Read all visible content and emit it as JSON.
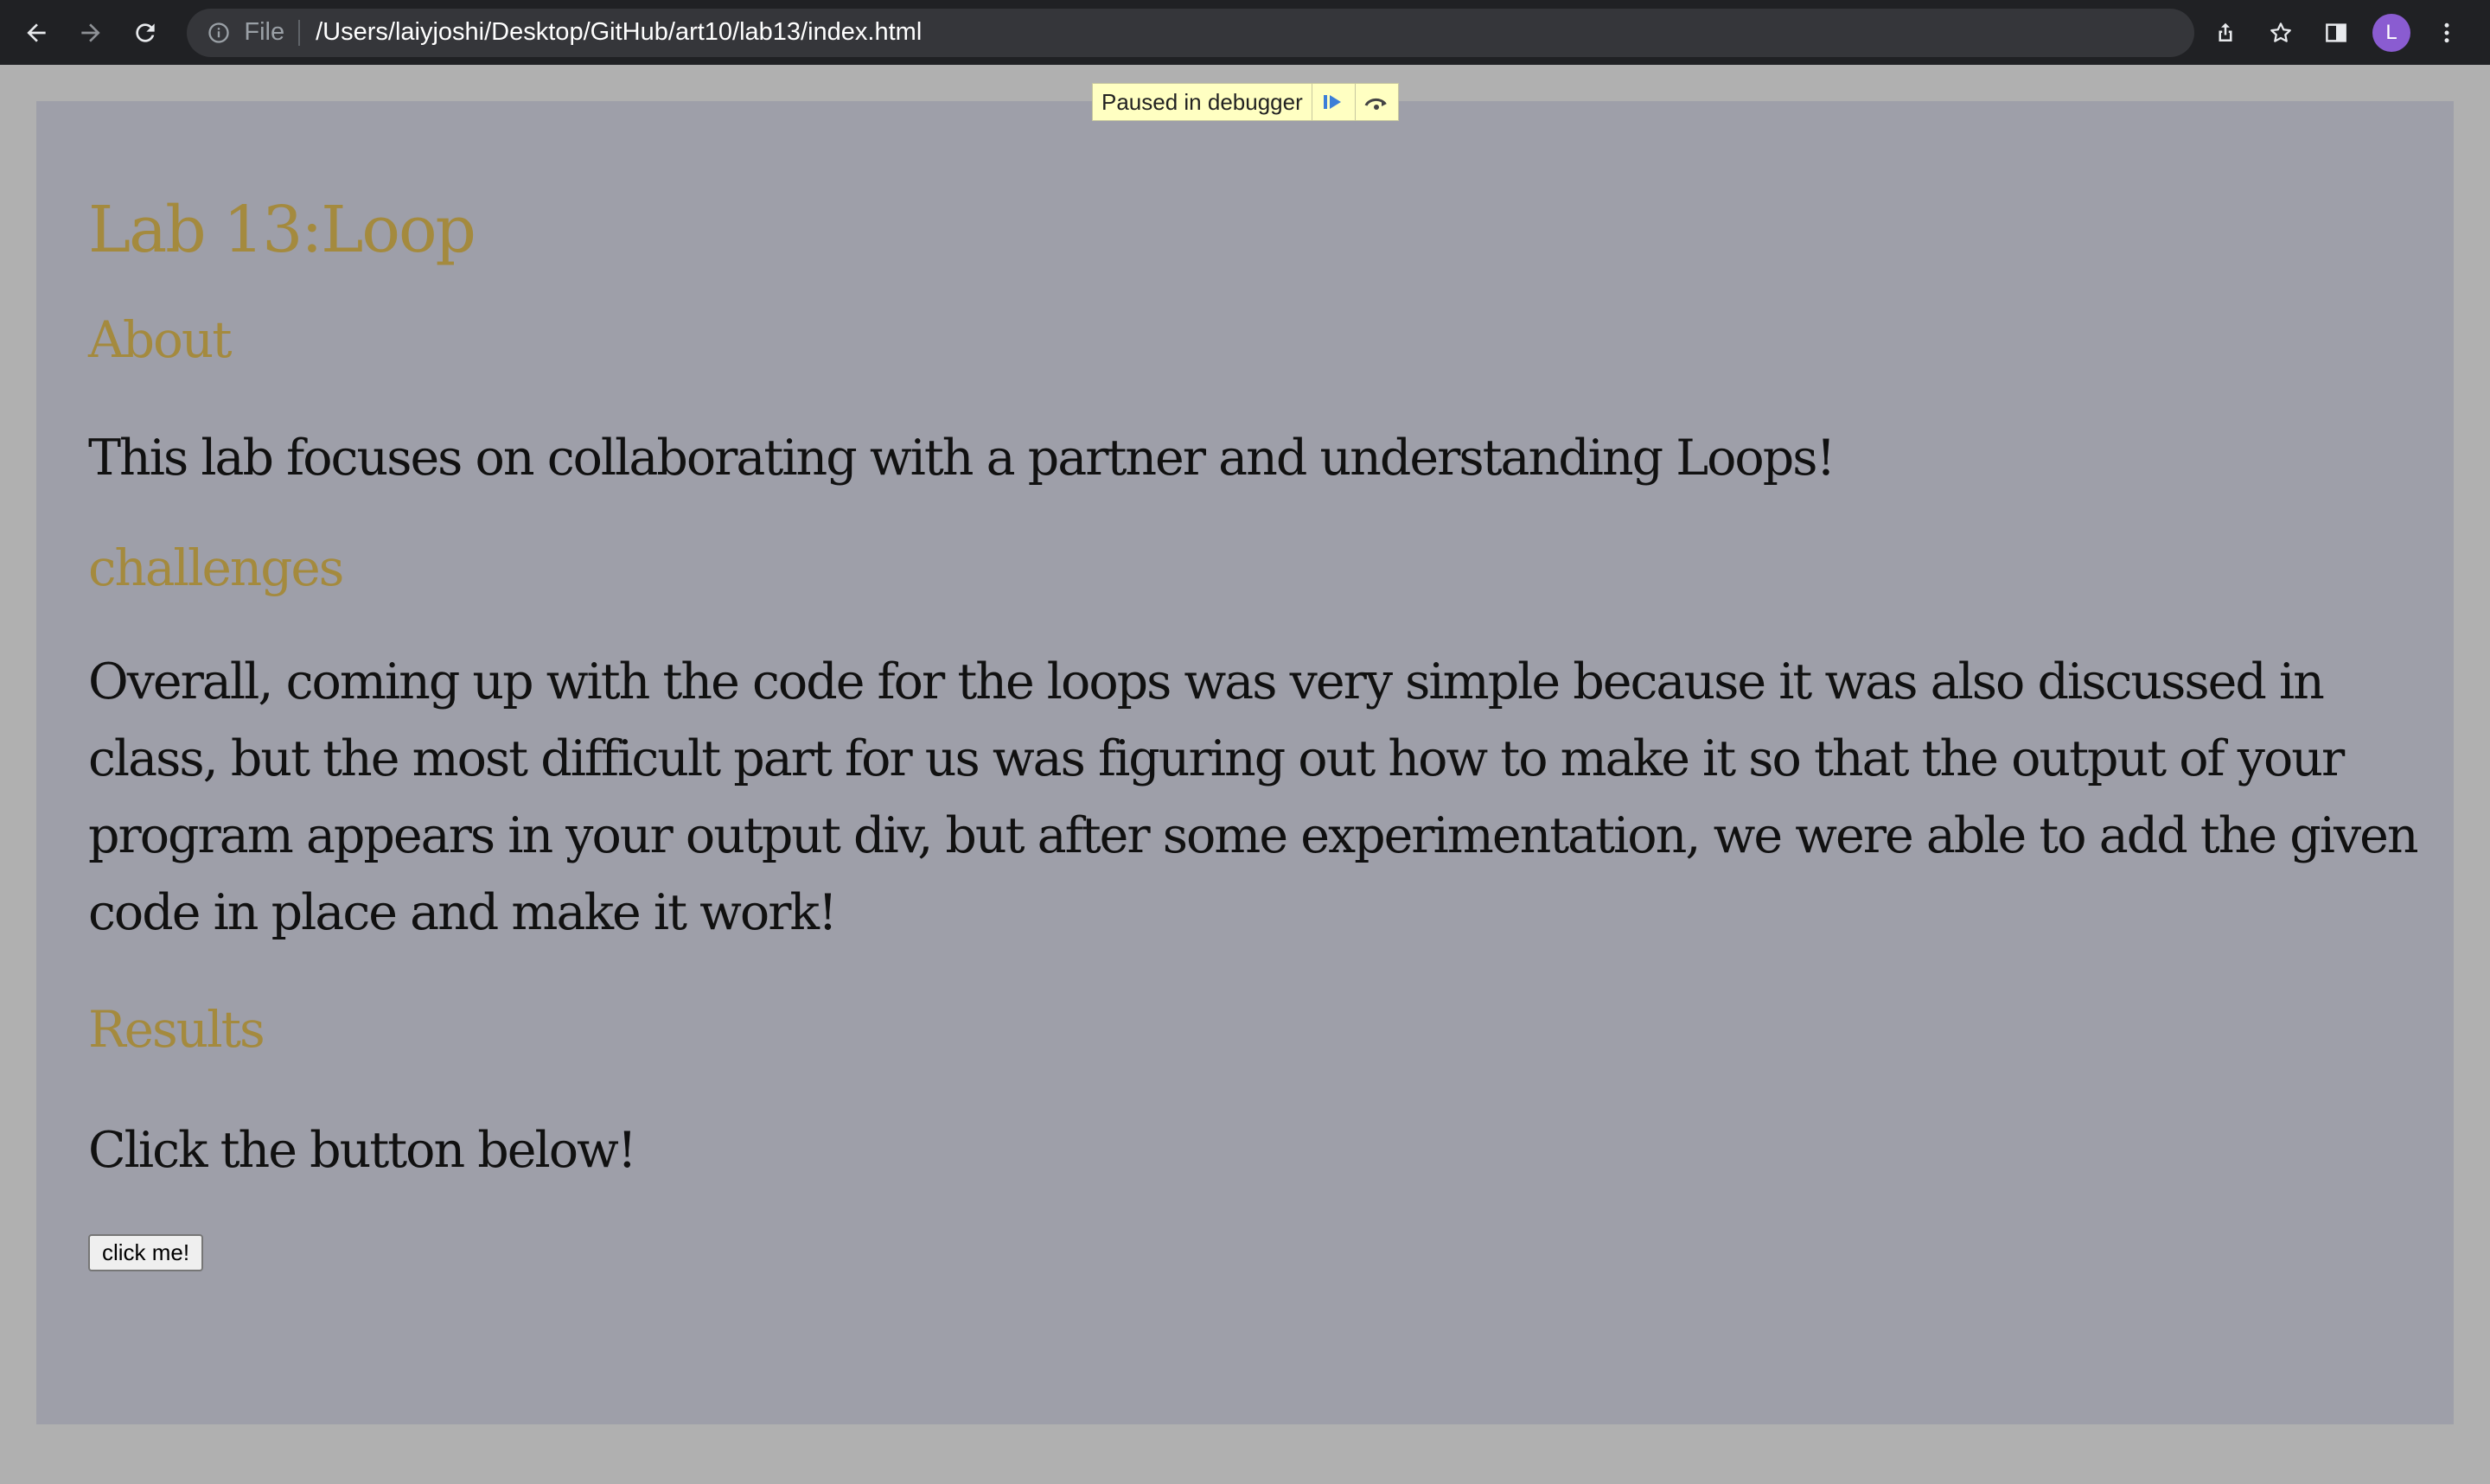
{
  "browser": {
    "scheme_label": "File",
    "url": "/Users/laiyjoshi/Desktop/GitHub/art10/lab13/index.html",
    "profile_initial": "L",
    "icons": [
      "back-icon",
      "forward-icon",
      "reload-icon",
      "info-icon",
      "share-icon",
      "bookmark-star-icon",
      "side-panel-icon",
      "more-menu-icon"
    ]
  },
  "debugger": {
    "label": "Paused in debugger",
    "resume_icon": "resume-icon",
    "step_over_icon": "step-over-icon"
  },
  "page": {
    "title": "Lab 13:Loop",
    "about_heading": "About",
    "about_text": "This lab focuses on collaborating with a partner and understanding Loops!",
    "challenges_heading": "challenges",
    "challenges_text": "Overall, coming up with the code for the loops was very simple because it was also discussed in class, but the most difficult part for us was figuring out how to make it so that the output of your program appears in your output div, but after some experimentation, we were able to add the given code in place and make it work!",
    "results_heading": "Results",
    "results_text": "Click the button below!",
    "button_label": "click me!"
  },
  "colors": {
    "heading": "#a48a3e",
    "content_bg": "#9e9fa9",
    "page_bg": "#b0b0b0",
    "toolbar_bg": "#202124",
    "debugger_bg": "#ffffc2"
  }
}
